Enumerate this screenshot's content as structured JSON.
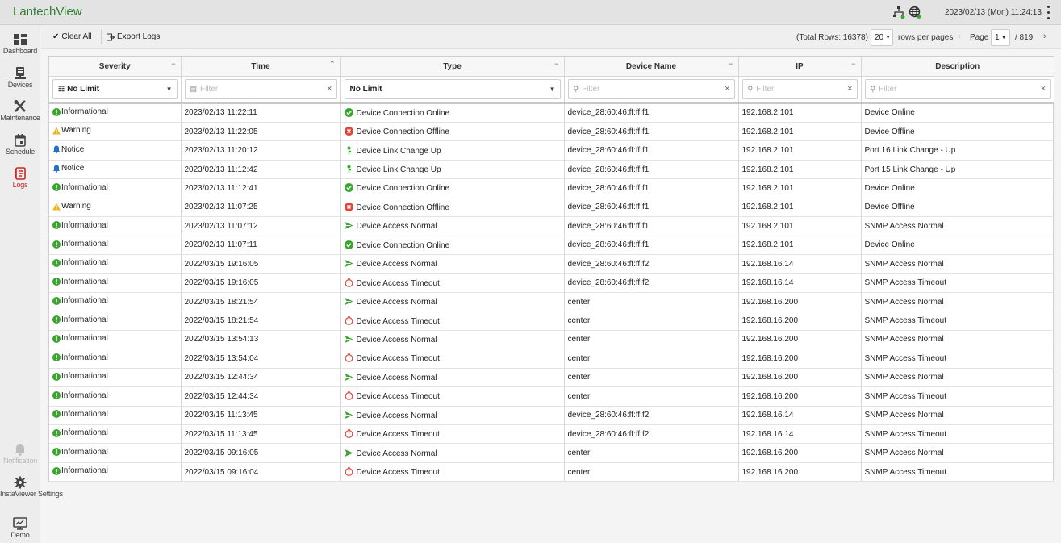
{
  "app": {
    "title": "LantechView",
    "clock": "2023/02/13 (Mon) 11:24:13"
  },
  "sidebar": {
    "items": [
      {
        "label": "Dashboard",
        "icon": "dashboard-icon"
      },
      {
        "label": "Devices",
        "icon": "devices-icon"
      },
      {
        "label": "Maintenance",
        "icon": "maintenance-icon"
      },
      {
        "label": "Schedule",
        "icon": "schedule-icon"
      },
      {
        "label": "Logs",
        "icon": "logs-icon"
      },
      {
        "label": "Notification",
        "icon": "bell-icon"
      },
      {
        "label": "InstaViewer Settings",
        "icon": "gear-icon"
      },
      {
        "label": "Demo",
        "icon": "demo-icon"
      }
    ],
    "active_color": "#c62828"
  },
  "toolbar": {
    "clear_all": "Clear All",
    "export_logs": "Export Logs",
    "total_rows": "(Total Rows: 16378)",
    "rows_per_page_value": "20",
    "rows_per_page_label": "rows per pages",
    "page_label": "Page",
    "page_value": "1",
    "page_total": "/ 819"
  },
  "table": {
    "columns": [
      "Severity",
      "Time",
      "Type",
      "Device Name",
      "IP",
      "Description"
    ],
    "filters": {
      "severity": "No Limit",
      "type": "No Limit",
      "placeholder": "Filter"
    },
    "rows": [
      [
        "Informational",
        "2023/02/13 11:22:11",
        "Device Connection Online",
        "device_28:60:46:ff:ff:f1",
        "192.168.2.101",
        "Device Online"
      ],
      [
        "Warning",
        "2023/02/13 11:22:05",
        "Device Connection Offline",
        "device_28:60:46:ff:ff:f1",
        "192.168.2.101",
        "Device Offline"
      ],
      [
        "Notice",
        "2023/02/13 11:20:12",
        "Device Link Change Up",
        "device_28:60:46:ff:ff:f1",
        "192.168.2.101",
        "Port 16 Link Change - Up"
      ],
      [
        "Notice",
        "2023/02/13 11:12:42",
        "Device Link Change Up",
        "device_28:60:46:ff:ff:f1",
        "192.168.2.101",
        "Port 15 Link Change - Up"
      ],
      [
        "Informational",
        "2023/02/13 11:12:41",
        "Device Connection Online",
        "device_28:60:46:ff:ff:f1",
        "192.168.2.101",
        "Device Online"
      ],
      [
        "Warning",
        "2023/02/13 11:07:25",
        "Device Connection Offline",
        "device_28:60:46:ff:ff:f1",
        "192.168.2.101",
        "Device Offline"
      ],
      [
        "Informational",
        "2023/02/13 11:07:12",
        "Device Access Normal",
        "device_28:60:46:ff:ff:f1",
        "192.168.2.101",
        "SNMP Access Normal"
      ],
      [
        "Informational",
        "2023/02/13 11:07:11",
        "Device Connection Online",
        "device_28:60:46:ff:ff:f1",
        "192.168.2.101",
        "Device Online"
      ],
      [
        "Informational",
        "2022/03/15 19:16:05",
        "Device Access Normal",
        "device_28:60:46:ff:ff:f2",
        "192.168.16.14",
        "SNMP Access Normal"
      ],
      [
        "Informational",
        "2022/03/15 19:16:05",
        "Device Access Timeout",
        "device_28:60:46:ff:ff:f2",
        "192.168.16.14",
        "SNMP Access Timeout"
      ],
      [
        "Informational",
        "2022/03/15 18:21:54",
        "Device Access Normal",
        "center",
        "192.168.16.200",
        "SNMP Access Normal"
      ],
      [
        "Informational",
        "2022/03/15 18:21:54",
        "Device Access Timeout",
        "center",
        "192.168.16.200",
        "SNMP Access Timeout"
      ],
      [
        "Informational",
        "2022/03/15 13:54:13",
        "Device Access Normal",
        "center",
        "192.168.16.200",
        "SNMP Access Normal"
      ],
      [
        "Informational",
        "2022/03/15 13:54:04",
        "Device Access Timeout",
        "center",
        "192.168.16.200",
        "SNMP Access Timeout"
      ],
      [
        "Informational",
        "2022/03/15 12:44:34",
        "Device Access Normal",
        "center",
        "192.168.16.200",
        "SNMP Access Normal"
      ],
      [
        "Informational",
        "2022/03/15 12:44:34",
        "Device Access Timeout",
        "center",
        "192.168.16.200",
        "SNMP Access Timeout"
      ],
      [
        "Informational",
        "2022/03/15 11:13:45",
        "Device Access Normal",
        "device_28:60:46:ff:ff:f2",
        "192.168.16.14",
        "SNMP Access Normal"
      ],
      [
        "Informational",
        "2022/03/15 11:13:45",
        "Device Access Timeout",
        "device_28:60:46:ff:ff:f2",
        "192.168.16.14",
        "SNMP Access Timeout"
      ],
      [
        "Informational",
        "2022/03/15 09:16:05",
        "Device Access Normal",
        "center",
        "192.168.16.200",
        "SNMP Access Normal"
      ],
      [
        "Informational",
        "2022/03/15 09:16:04",
        "Device Access Timeout",
        "center",
        "192.168.16.200",
        "SNMP Access Timeout"
      ]
    ]
  },
  "colors": {
    "brand": "#2e7d32",
    "informational": "#3aa62f",
    "warning": "#f2b21b",
    "notice": "#1f6fd1",
    "offline": "#e0473a",
    "timeout": "#e0473a"
  }
}
